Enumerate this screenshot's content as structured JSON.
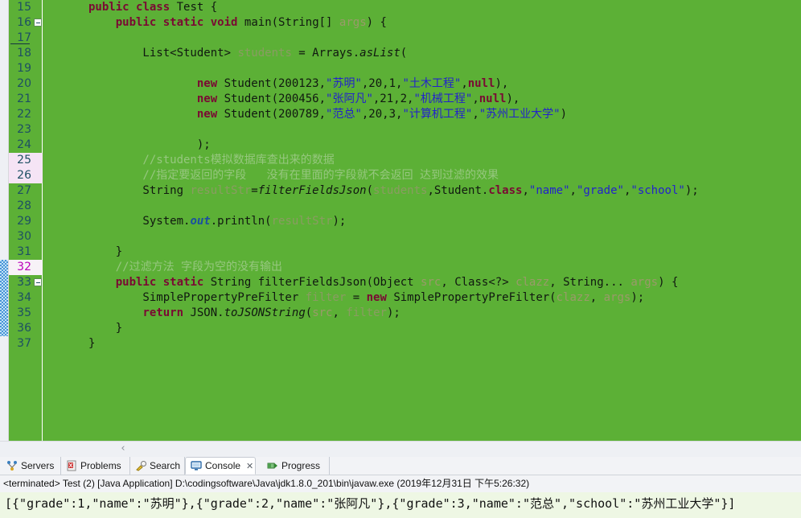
{
  "editor": {
    "background_color": "#5cb036",
    "first_line": 15,
    "current_line": 32,
    "changed_lines": [
      25,
      26
    ],
    "annotation_range": [
      32,
      36
    ],
    "fold_marker_lines": [
      16,
      33
    ],
    "lines": [
      {
        "n": 15,
        "segments": [
          {
            "t": "public ",
            "c": "kw"
          },
          {
            "t": "class ",
            "c": "kw"
          },
          {
            "t": "Test {",
            "c": "plain"
          }
        ]
      },
      {
        "n": 16,
        "segments": [
          {
            "t": "    ",
            "c": "plain"
          },
          {
            "t": "public ",
            "c": "kw"
          },
          {
            "t": "static ",
            "c": "kw"
          },
          {
            "t": "void ",
            "c": "kw"
          },
          {
            "t": "main(String[] ",
            "c": "plain"
          },
          {
            "t": "args",
            "c": "par"
          },
          {
            "t": ") {",
            "c": "plain"
          }
        ]
      },
      {
        "n": 17,
        "segments": []
      },
      {
        "n": 18,
        "segments": [
          {
            "t": "        List<Student> ",
            "c": "plain"
          },
          {
            "t": "students",
            "c": "loc"
          },
          {
            "t": " = Arrays.",
            "c": "plain"
          },
          {
            "t": "asList",
            "c": "ital"
          },
          {
            "t": "(",
            "c": "plain"
          }
        ]
      },
      {
        "n": 19,
        "segments": []
      },
      {
        "n": 20,
        "segments": [
          {
            "t": "                ",
            "c": "plain"
          },
          {
            "t": "new ",
            "c": "kw"
          },
          {
            "t": "Student(200123,",
            "c": "plain"
          },
          {
            "t": "\"苏明\"",
            "c": "str"
          },
          {
            "t": ",20,1,",
            "c": "plain"
          },
          {
            "t": "\"土木工程\"",
            "c": "str"
          },
          {
            "t": ",",
            "c": "plain"
          },
          {
            "t": "null",
            "c": "kw"
          },
          {
            "t": "),",
            "c": "plain"
          }
        ]
      },
      {
        "n": 21,
        "segments": [
          {
            "t": "                ",
            "c": "plain"
          },
          {
            "t": "new ",
            "c": "kw"
          },
          {
            "t": "Student(200456,",
            "c": "plain"
          },
          {
            "t": "\"张阿凡\"",
            "c": "str"
          },
          {
            "t": ",21,2,",
            "c": "plain"
          },
          {
            "t": "\"机械工程\"",
            "c": "str"
          },
          {
            "t": ",",
            "c": "plain"
          },
          {
            "t": "null",
            "c": "kw"
          },
          {
            "t": "),",
            "c": "plain"
          }
        ]
      },
      {
        "n": 22,
        "segments": [
          {
            "t": "                ",
            "c": "plain"
          },
          {
            "t": "new ",
            "c": "kw"
          },
          {
            "t": "Student(200789,",
            "c": "plain"
          },
          {
            "t": "\"范总\"",
            "c": "str"
          },
          {
            "t": ",20,3,",
            "c": "plain"
          },
          {
            "t": "\"计算机工程\"",
            "c": "str"
          },
          {
            "t": ",",
            "c": "plain"
          },
          {
            "t": "\"苏州工业大学\"",
            "c": "str"
          },
          {
            "t": ")",
            "c": "plain"
          }
        ]
      },
      {
        "n": 23,
        "segments": []
      },
      {
        "n": 24,
        "segments": [
          {
            "t": "                );",
            "c": "plain"
          }
        ]
      },
      {
        "n": 25,
        "segments": [
          {
            "t": "        //students模拟数据库查出来的数据",
            "c": "cmt"
          }
        ]
      },
      {
        "n": 26,
        "segments": [
          {
            "t": "        //指定要返回的字段   没有在里面的字段就不会返回 达到过滤的效果",
            "c": "cmt"
          }
        ]
      },
      {
        "n": 27,
        "segments": [
          {
            "t": "        String ",
            "c": "plain"
          },
          {
            "t": "resultStr",
            "c": "loc"
          },
          {
            "t": "=",
            "c": "plain"
          },
          {
            "t": "filterFieldsJson",
            "c": "ital"
          },
          {
            "t": "(",
            "c": "plain"
          },
          {
            "t": "students",
            "c": "loc"
          },
          {
            "t": ",Student.",
            "c": "plain"
          },
          {
            "t": "class",
            "c": "kw"
          },
          {
            "t": ",",
            "c": "plain"
          },
          {
            "t": "\"name\"",
            "c": "str"
          },
          {
            "t": ",",
            "c": "plain"
          },
          {
            "t": "\"grade\"",
            "c": "str"
          },
          {
            "t": ",",
            "c": "plain"
          },
          {
            "t": "\"school\"",
            "c": "str"
          },
          {
            "t": ");",
            "c": "plain"
          }
        ]
      },
      {
        "n": 28,
        "segments": []
      },
      {
        "n": 29,
        "segments": [
          {
            "t": "        System.",
            "c": "plain"
          },
          {
            "t": "out",
            "c": "fld"
          },
          {
            "t": ".println(",
            "c": "plain"
          },
          {
            "t": "resultStr",
            "c": "loc"
          },
          {
            "t": ");",
            "c": "plain"
          }
        ]
      },
      {
        "n": 30,
        "segments": []
      },
      {
        "n": 31,
        "segments": [
          {
            "t": "    }",
            "c": "plain"
          }
        ]
      },
      {
        "n": 32,
        "segments": [
          {
            "t": "    //过滤方法 字段为空的没有输出",
            "c": "cmt"
          }
        ]
      },
      {
        "n": 33,
        "segments": [
          {
            "t": "    ",
            "c": "plain"
          },
          {
            "t": "public ",
            "c": "kw"
          },
          {
            "t": "static ",
            "c": "kw"
          },
          {
            "t": "String filterFieldsJson(Object ",
            "c": "plain"
          },
          {
            "t": "src",
            "c": "par"
          },
          {
            "t": ", Class<?> ",
            "c": "plain"
          },
          {
            "t": "clazz",
            "c": "par"
          },
          {
            "t": ", String... ",
            "c": "plain"
          },
          {
            "t": "args",
            "c": "par"
          },
          {
            "t": ") {",
            "c": "plain"
          }
        ]
      },
      {
        "n": 34,
        "segments": [
          {
            "t": "        SimplePropertyPreFilter ",
            "c": "plain"
          },
          {
            "t": "filter",
            "c": "loc"
          },
          {
            "t": " = ",
            "c": "plain"
          },
          {
            "t": "new ",
            "c": "kw"
          },
          {
            "t": "SimplePropertyPreFilter(",
            "c": "plain"
          },
          {
            "t": "clazz",
            "c": "par"
          },
          {
            "t": ", ",
            "c": "plain"
          },
          {
            "t": "args",
            "c": "par"
          },
          {
            "t": ");",
            "c": "plain"
          }
        ]
      },
      {
        "n": 35,
        "segments": [
          {
            "t": "        ",
            "c": "plain"
          },
          {
            "t": "return ",
            "c": "kw"
          },
          {
            "t": "JSON.",
            "c": "plain"
          },
          {
            "t": "toJSONString",
            "c": "ital"
          },
          {
            "t": "(",
            "c": "plain"
          },
          {
            "t": "src",
            "c": "par"
          },
          {
            "t": ", ",
            "c": "plain"
          },
          {
            "t": "filter",
            "c": "loc"
          },
          {
            "t": ");",
            "c": "plain"
          }
        ]
      },
      {
        "n": 36,
        "segments": [
          {
            "t": "    }",
            "c": "plain"
          }
        ]
      },
      {
        "n": 37,
        "segments": [
          {
            "t": "}",
            "c": "plain"
          }
        ]
      }
    ]
  },
  "hscrollbar": {
    "left_arrow": "‹"
  },
  "panel": {
    "tabs": [
      {
        "label": "Servers",
        "icon": "servers-icon",
        "active": false,
        "closable": false
      },
      {
        "label": "Problems",
        "icon": "problems-icon",
        "active": false,
        "closable": false
      },
      {
        "label": "Search",
        "icon": "search-icon",
        "active": false,
        "closable": false
      },
      {
        "label": "Console",
        "icon": "console-icon",
        "active": true,
        "closable": true,
        "close_glyph": "✕"
      },
      {
        "label": "Progress",
        "icon": "progress-icon",
        "active": false,
        "closable": false
      }
    ],
    "terminated_line": "<terminated> Test (2) [Java Application] D:\\codingsoftware\\Java\\jdk1.8.0_201\\bin\\javaw.exe (2019年12月31日 下午5:26:32)",
    "console_output": "[{\"grade\":1,\"name\":\"苏明\"},{\"grade\":2,\"name\":\"张阿凡\"},{\"grade\":3,\"name\":\"范总\",\"school\":\"苏州工业大学\"}]",
    "console_background": "#eef7e4"
  }
}
